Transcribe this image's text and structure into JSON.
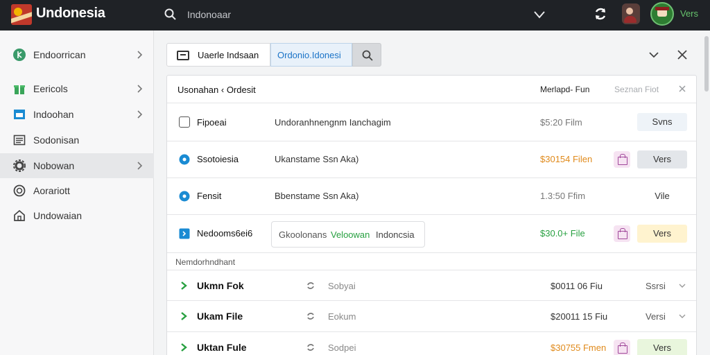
{
  "app": {
    "title": "Undonesia"
  },
  "search": {
    "placeholder": "Indonoaar"
  },
  "user": {
    "label": "Vers"
  },
  "sidebar": {
    "items": [
      {
        "label": "Endoorrican",
        "icon": "globe-icon",
        "color": "#3a9a6a"
      },
      {
        "label": "Eericols",
        "icon": "gift-icon",
        "color": "#3aa55a"
      },
      {
        "label": "Indoohan",
        "icon": "window-icon",
        "color": "#1a8bd3"
      },
      {
        "label": "Sodonisan",
        "icon": "list-icon",
        "color": "#444444"
      },
      {
        "label": "Nobowan",
        "icon": "gear-icon",
        "color": "#444444"
      },
      {
        "label": "Aorariott",
        "icon": "circle-icon",
        "color": "#444444"
      },
      {
        "label": "Undowaian",
        "icon": "home-icon",
        "color": "#444444"
      }
    ]
  },
  "toolbar": {
    "tab_a": "Uaerle Indsaan",
    "tab_b": "Ordonio.Idonesi"
  },
  "table": {
    "header": {
      "title": "Usonahan ‹ Ordesit",
      "sort": "Merlapd- Fun",
      "search": "Seznan Fiot"
    },
    "rows": [
      {
        "name": "Fipoeai",
        "desc": "Undoranhnengnm Ianchagim",
        "meta": "$5:20 Film",
        "action": "Svns"
      },
      {
        "name": "Ssotoiesia",
        "desc": "Ukanstame Ssn Aka)",
        "meta": "$30154 Filen",
        "action": "Vers"
      },
      {
        "name": "Fensit",
        "desc": "Bbenstame Ssn Aka)",
        "meta": "1.3:50 Ffim",
        "action": "Vile"
      },
      {
        "name": "Nedooms6ei6",
        "desc_parts": [
          "Gkoolonans",
          "Veloowan",
          "Indoncsia"
        ],
        "meta": "$30.0+ File",
        "action": "Vers"
      }
    ],
    "section_label": "Nemdorhndhant",
    "files": [
      {
        "name": "Ukmn Fok",
        "type": "Sobyai",
        "size": "$0011 06 Fiu",
        "version": "Ssrsi"
      },
      {
        "name": "Ukam File",
        "type": "Eokum",
        "size": "$20011 15 Fiu",
        "version": "Versi"
      },
      {
        "name": "Uktan Fule",
        "type": "Sodpei",
        "size": "$30755 Fmen",
        "version": "Vers"
      }
    ]
  }
}
